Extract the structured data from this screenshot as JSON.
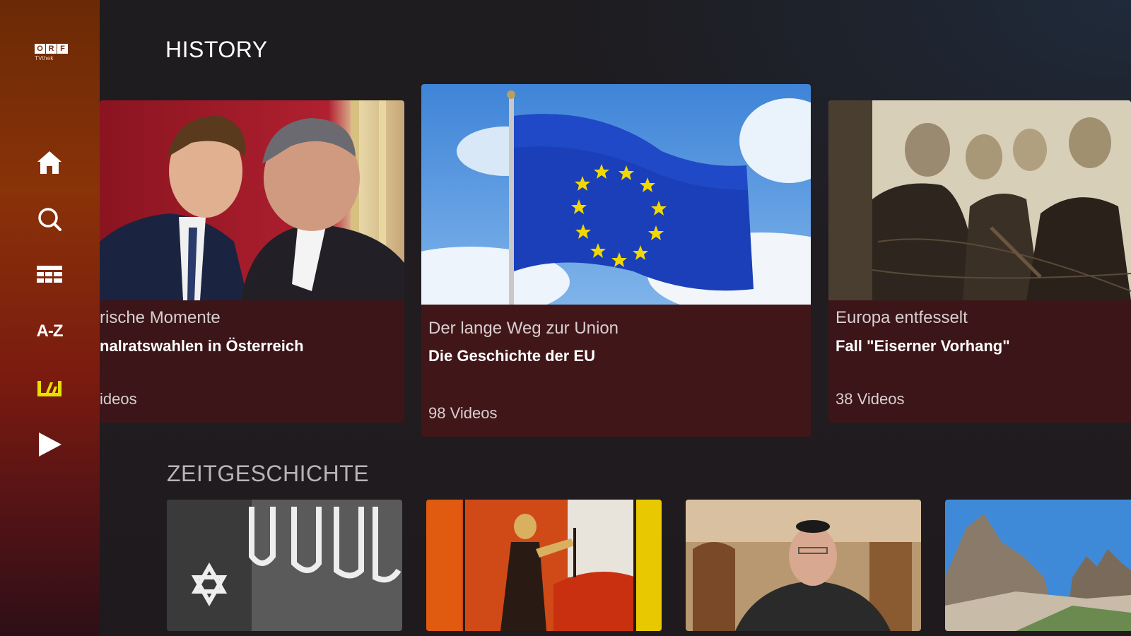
{
  "brand": {
    "logo_letters": [
      "O",
      "R",
      "F"
    ],
    "logo_sub": "TVthek"
  },
  "sidebar": {
    "items": [
      {
        "name": "home",
        "icon": "home-icon"
      },
      {
        "name": "search",
        "icon": "search-icon"
      },
      {
        "name": "program",
        "icon": "schedule-grid-icon"
      },
      {
        "name": "az",
        "label": "A-Z"
      },
      {
        "name": "live",
        "icon": "live-bars-icon"
      },
      {
        "name": "play",
        "icon": "play-icon"
      }
    ],
    "active_color": "#e8e000"
  },
  "sections": {
    "history": "HISTORY",
    "zeitgeschichte": "ZEITGESCHICHTE"
  },
  "cards": [
    {
      "title": "rische Momente",
      "subtitle": "nalratswahlen in Österreich",
      "count": "ideos"
    },
    {
      "title": "Der lange Weg zur Union",
      "subtitle": "Die Geschichte der EU",
      "count": "98 Videos"
    },
    {
      "title": "Europa entfesselt",
      "subtitle": "Fall \"Eiserner Vorhang\"",
      "count": "38 Videos"
    }
  ],
  "colors": {
    "card_bg": "#3c1518",
    "accent": "#e8e000"
  }
}
